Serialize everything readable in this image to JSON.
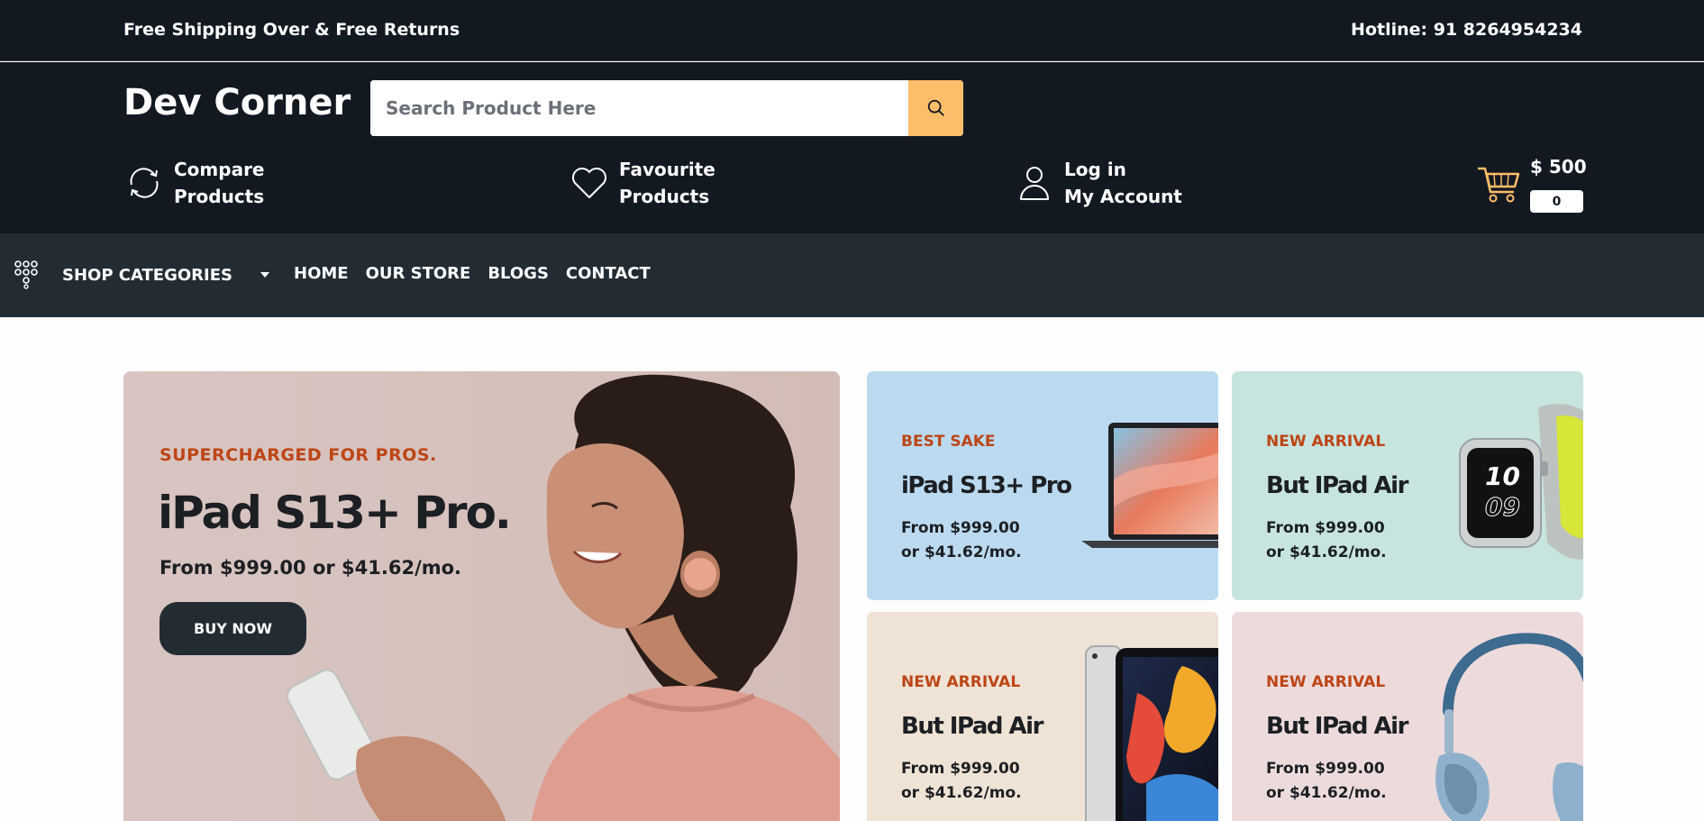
{
  "topbar": {
    "promo": "Free Shipping Over & Free Returns",
    "hotline": "Hotline: 91 8264954234"
  },
  "header": {
    "logo": "Dev Corner",
    "search_placeholder": "Search Product Here",
    "compare": [
      "Compare",
      "Products"
    ],
    "favourite": [
      "Favourite",
      "Products"
    ],
    "account": [
      "Log in",
      "My Account"
    ],
    "cart_total": "$ 500",
    "cart_count": "0"
  },
  "nav": {
    "categories_label": "SHOP CATEGORIES",
    "items": [
      "HOME",
      "OUR STORE",
      "BLOGS",
      "CONTACT"
    ]
  },
  "hero": {
    "kicker": "SUPERCHARGED FOR PROS.",
    "title": "iPad S13+ Pro.",
    "price": "From $999.00 or $41.62/mo.",
    "button": "BUY NOW"
  },
  "cards": [
    {
      "kicker": "BEST SAKE",
      "title": "iPad S13+ Pro",
      "price_line1": "From $999.00",
      "price_line2": "or $41.62/mo.",
      "image": "laptop"
    },
    {
      "kicker": "NEW ARRIVAL",
      "title": "But IPad Air",
      "price_line1": "From $999.00",
      "price_line2": "or $41.62/mo.",
      "image": "smartwatch"
    },
    {
      "kicker": "NEW ARRIVAL",
      "title": "But IPad Air",
      "price_line1": "From $999.00",
      "price_line2": "or $41.62/mo.",
      "image": "tablet"
    },
    {
      "kicker": "NEW ARRIVAL",
      "title": "But IPad Air",
      "price_line1": "From $999.00",
      "price_line2": "or $41.62/mo.",
      "image": "headphones"
    }
  ],
  "colors": {
    "header_bg": "#131921",
    "nav_bg": "#232c33",
    "accent": "#febd69",
    "kicker": "#bd4516"
  }
}
